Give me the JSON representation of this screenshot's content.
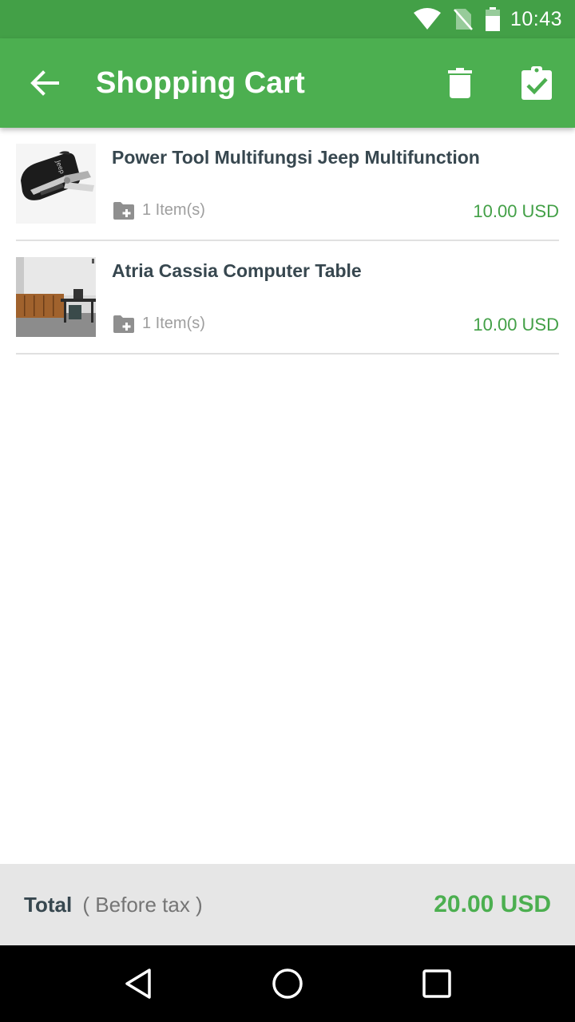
{
  "status_bar": {
    "time": "10:43",
    "icons": [
      "wifi-icon",
      "no-sim-icon",
      "battery-icon"
    ]
  },
  "app_bar": {
    "title": "Shopping Cart",
    "icons": [
      "back-arrow-icon",
      "trash-icon",
      "clipboard-check-icon"
    ]
  },
  "cart": {
    "items": [
      {
        "name": "Power Tool Multifungsi Jeep Multifunction",
        "quantity": "1 Item(s)",
        "price": "10.00 USD",
        "image": "multitool-with-black-pouch"
      },
      {
        "name": "Atria Cassia Computer Table",
        "quantity": "1 Item(s)",
        "price": "10.00 USD",
        "image": "computer-table-room"
      }
    ]
  },
  "total": {
    "label": "Total",
    "note": "( Before tax )",
    "value": "20.00 USD"
  },
  "nav_bar": {
    "icons": [
      "back-triangle-icon",
      "home-circle-icon",
      "recents-square-icon"
    ]
  },
  "colors": {
    "status_bar": "#43a047",
    "app_bar": "#4caf50",
    "price": "#43a047",
    "title_text": "#37474f",
    "footer_bg": "#e6e6e6"
  }
}
